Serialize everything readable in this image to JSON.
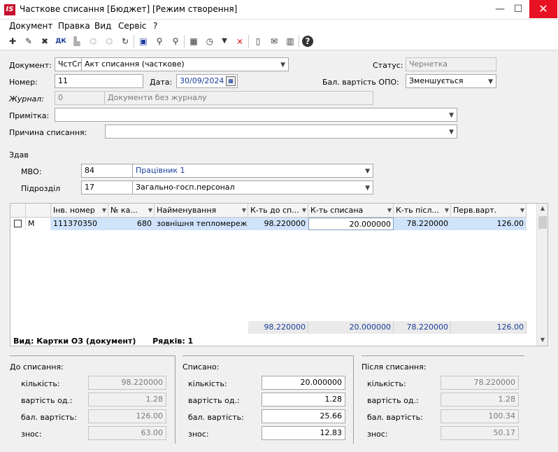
{
  "window": {
    "title": "Часткове списання [Бюджет] [Режим створення]",
    "logo_text": "IS",
    "minimize": "—",
    "maximize": "☐",
    "close": "✕"
  },
  "menu": [
    "Документ",
    "Правка",
    "Вид",
    "Сервіс",
    "?"
  ],
  "toolbar": [
    {
      "name": "new-doc-icon",
      "glyph": "✚"
    },
    {
      "name": "edit-doc-icon",
      "glyph": "✎"
    },
    {
      "name": "delete-doc-icon",
      "glyph": "✖"
    },
    {
      "name": "dk-icon",
      "glyph": "ДК"
    },
    {
      "name": "stamp-icon",
      "glyph": "▙"
    },
    {
      "name": "tree-icon",
      "glyph": "⌬"
    },
    {
      "name": "tree2-icon",
      "glyph": "⌬"
    },
    {
      "name": "refresh-icon",
      "glyph": "↻"
    },
    {
      "name": "save-icon",
      "glyph": "▣"
    },
    {
      "name": "find-icon",
      "glyph": "⚲"
    },
    {
      "name": "find-next-icon",
      "glyph": "⚲"
    },
    {
      "name": "table-icon",
      "glyph": "▦"
    },
    {
      "name": "clock-icon",
      "glyph": "◷"
    },
    {
      "name": "filter-icon",
      "glyph": "▼"
    },
    {
      "name": "clear-filter-icon",
      "glyph": "⨯"
    },
    {
      "name": "page-icon",
      "glyph": "▯"
    },
    {
      "name": "mail-icon",
      "glyph": "✉"
    },
    {
      "name": "columns-icon",
      "glyph": "▥"
    },
    {
      "name": "help-icon",
      "glyph": "?"
    }
  ],
  "form": {
    "document_label": "Документ:",
    "document_code": "ЧстСп",
    "document_name": "Акт списання (часткове)",
    "status_label": "Статус:",
    "status_value": "Чернетка",
    "number_label": "Номер:",
    "number_value": "11",
    "date_label": "Дата:",
    "date_value": "30/09/2024",
    "balance_label": "Бал. вартість ОПО:",
    "balance_value": "Зменшується",
    "journal_label": "Журнал:",
    "journal_code": "0",
    "journal_name": "Документи без журналу",
    "note_label": "Примітка:",
    "note_value": "",
    "reason_label": "Причина списання:",
    "reason_value": "",
    "handed_label": "Здав",
    "mvo_label": "МВО:",
    "mvo_code": "84",
    "mvo_name": "Працівник 1",
    "division_label": "Підрозділ",
    "division_code": "17",
    "division_name": "Загально-госп.персонал"
  },
  "grid": {
    "columns": [
      "",
      "Інв. номер",
      "№ ка...",
      "Найменування",
      "К-ть до сп...",
      "К-ть списана",
      "К-ть післ...",
      "Перв.варт."
    ],
    "row": {
      "flag": "М",
      "inv": "111370350",
      "card": "680",
      "name": "зовнішня тепломережа",
      "qty_before": "98.220000",
      "qty_written": "20.000000",
      "qty_after": "78.220000",
      "initial": "126.00"
    },
    "totals": {
      "qty_before": "98.220000",
      "qty_written": "20.000000",
      "qty_after": "78.220000",
      "initial": "126.00"
    },
    "view_label": "Вид: Картки ОЗ (документ)",
    "rows_label": "Рядків: 1"
  },
  "summary": {
    "before": {
      "title": "До списання:",
      "qty_label": "кількість:",
      "qty": "98.220000",
      "unit_label": "вартість од.:",
      "unit": "1.28",
      "bal_label": "бал. вартість:",
      "bal": "126.00",
      "wear_label": "знос:",
      "wear": "63.00"
    },
    "written": {
      "title": "Списано:",
      "qty_label": "кількість:",
      "qty": "20.000000",
      "unit_label": "вартість од.:",
      "unit": "1.28",
      "bal_label": "бал. вартість:",
      "bal": "25.66",
      "wear_label": "знос:",
      "wear": "12.83"
    },
    "after": {
      "title": "Після списання:",
      "qty_label": "кількість:",
      "qty": "78.220000",
      "unit_label": "вартість од.:",
      "unit": "1.28",
      "bal_label": "бал. вартість:",
      "bal": "100.34",
      "wear_label": "знос:",
      "wear": "50.17"
    }
  }
}
